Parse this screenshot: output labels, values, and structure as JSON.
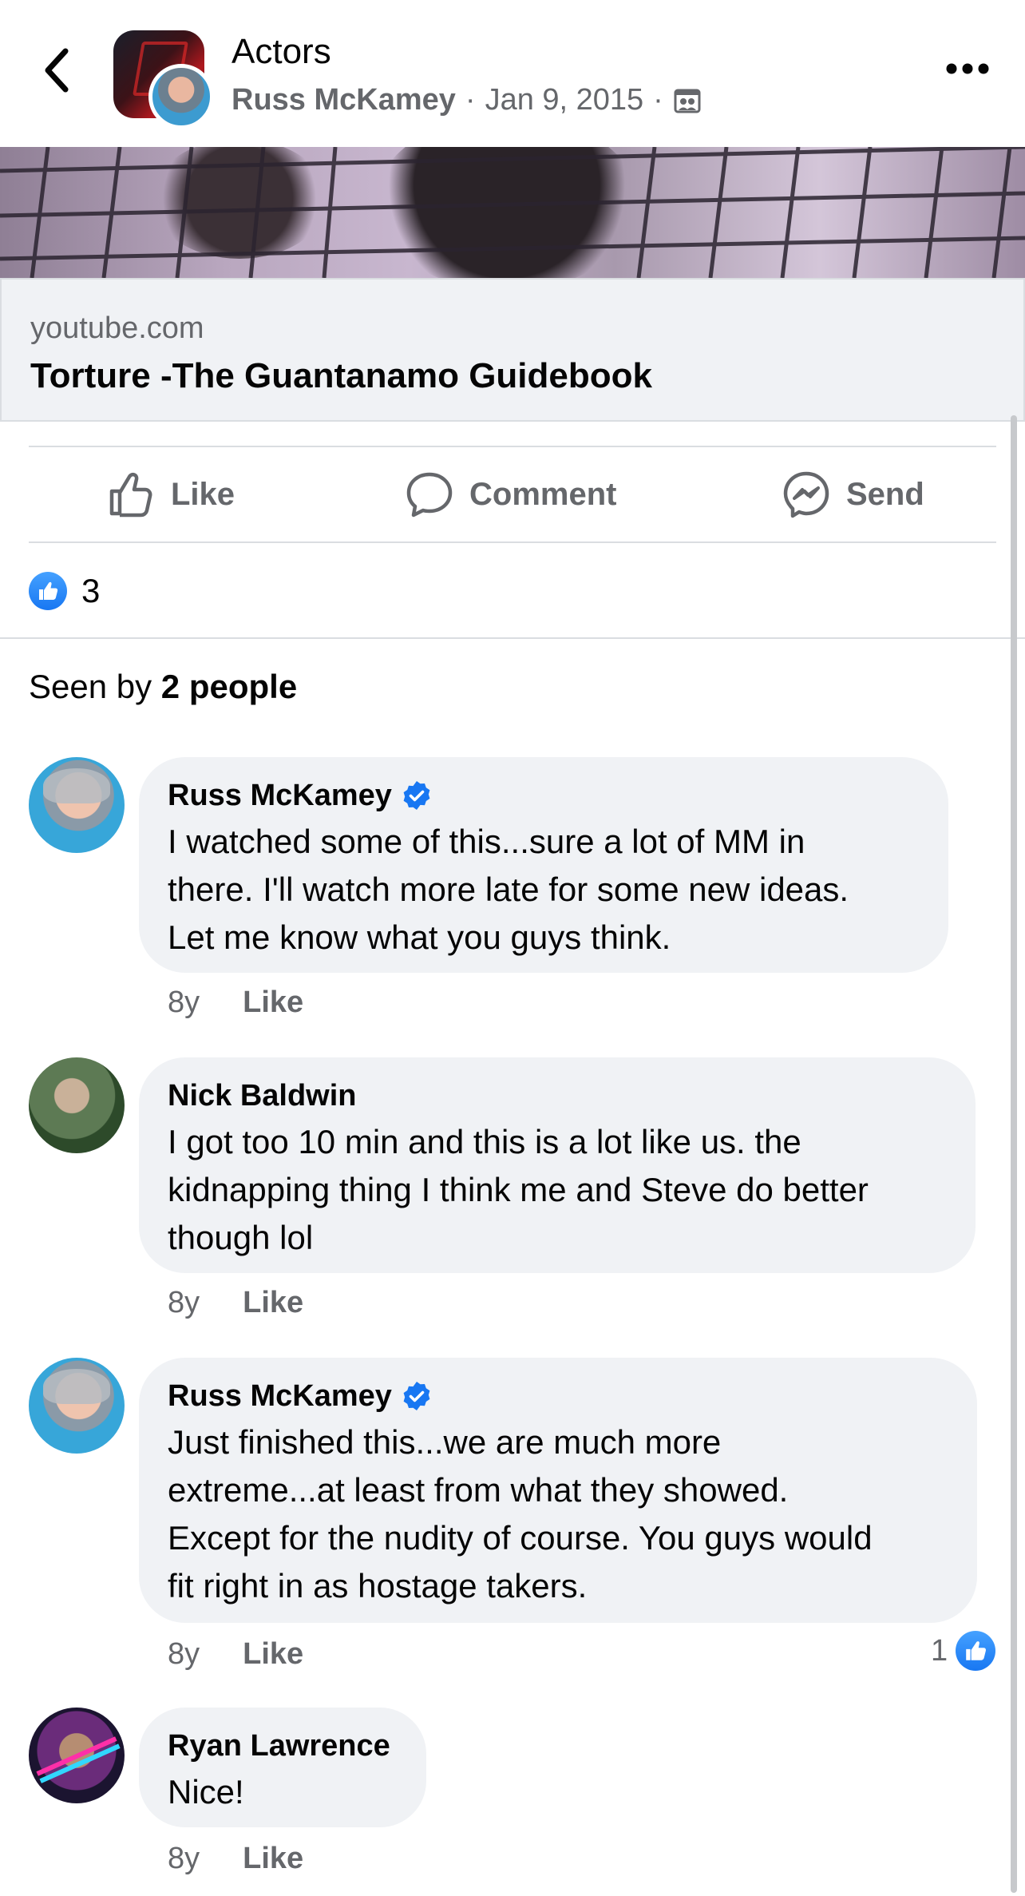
{
  "header": {
    "group_name": "Actors",
    "author": "Russ McKamey",
    "separator": "·",
    "date": "Jan 9, 2015",
    "privacy_icon": "members-only-icon",
    "back_icon": "chevron-left-icon",
    "more_icon": "more-horizontal-icon"
  },
  "link_preview": {
    "domain": "youtube.com",
    "title": "Torture -The Guantanamo Guidebook"
  },
  "actions": {
    "like_label": "Like",
    "comment_label": "Comment",
    "send_label": "Send"
  },
  "reactions": {
    "count": "3",
    "icon": "thumbs-up-icon"
  },
  "seen_by": {
    "prefix": "Seen by ",
    "count_text": "2 people"
  },
  "comments": [
    {
      "author": "Russ McKamey",
      "verified": true,
      "text_lines": [
        "I watched some of this...sure a lot of MM in",
        "there. I'll watch more late for some new ideas.",
        "Let me know what you guys think."
      ],
      "time": "8y",
      "like_label": "Like"
    },
    {
      "author": "Nick Baldwin",
      "verified": false,
      "text_lines": [
        "I got too 10 min and this is a lot like us. the",
        "kidnapping thing I think me and Steve do better",
        "though lol"
      ],
      "time": "8y",
      "like_label": "Like"
    },
    {
      "author": "Russ McKamey",
      "verified": true,
      "text_lines": [
        "Just finished this...we are much more",
        "extreme...at least from what they showed.",
        "Except for the nudity of course. You guys would",
        "fit right in as hostage takers."
      ],
      "time": "8y",
      "like_label": "Like",
      "reaction_count": "1"
    },
    {
      "author": "Ryan Lawrence",
      "verified": false,
      "text_lines": [
        "Nice!"
      ],
      "time": "8y",
      "like_label": "Like"
    }
  ],
  "colors": {
    "accent": "#1877f2",
    "secondary_text": "#65676b",
    "bubble": "#f0f2f5",
    "divider": "#dadde1"
  }
}
